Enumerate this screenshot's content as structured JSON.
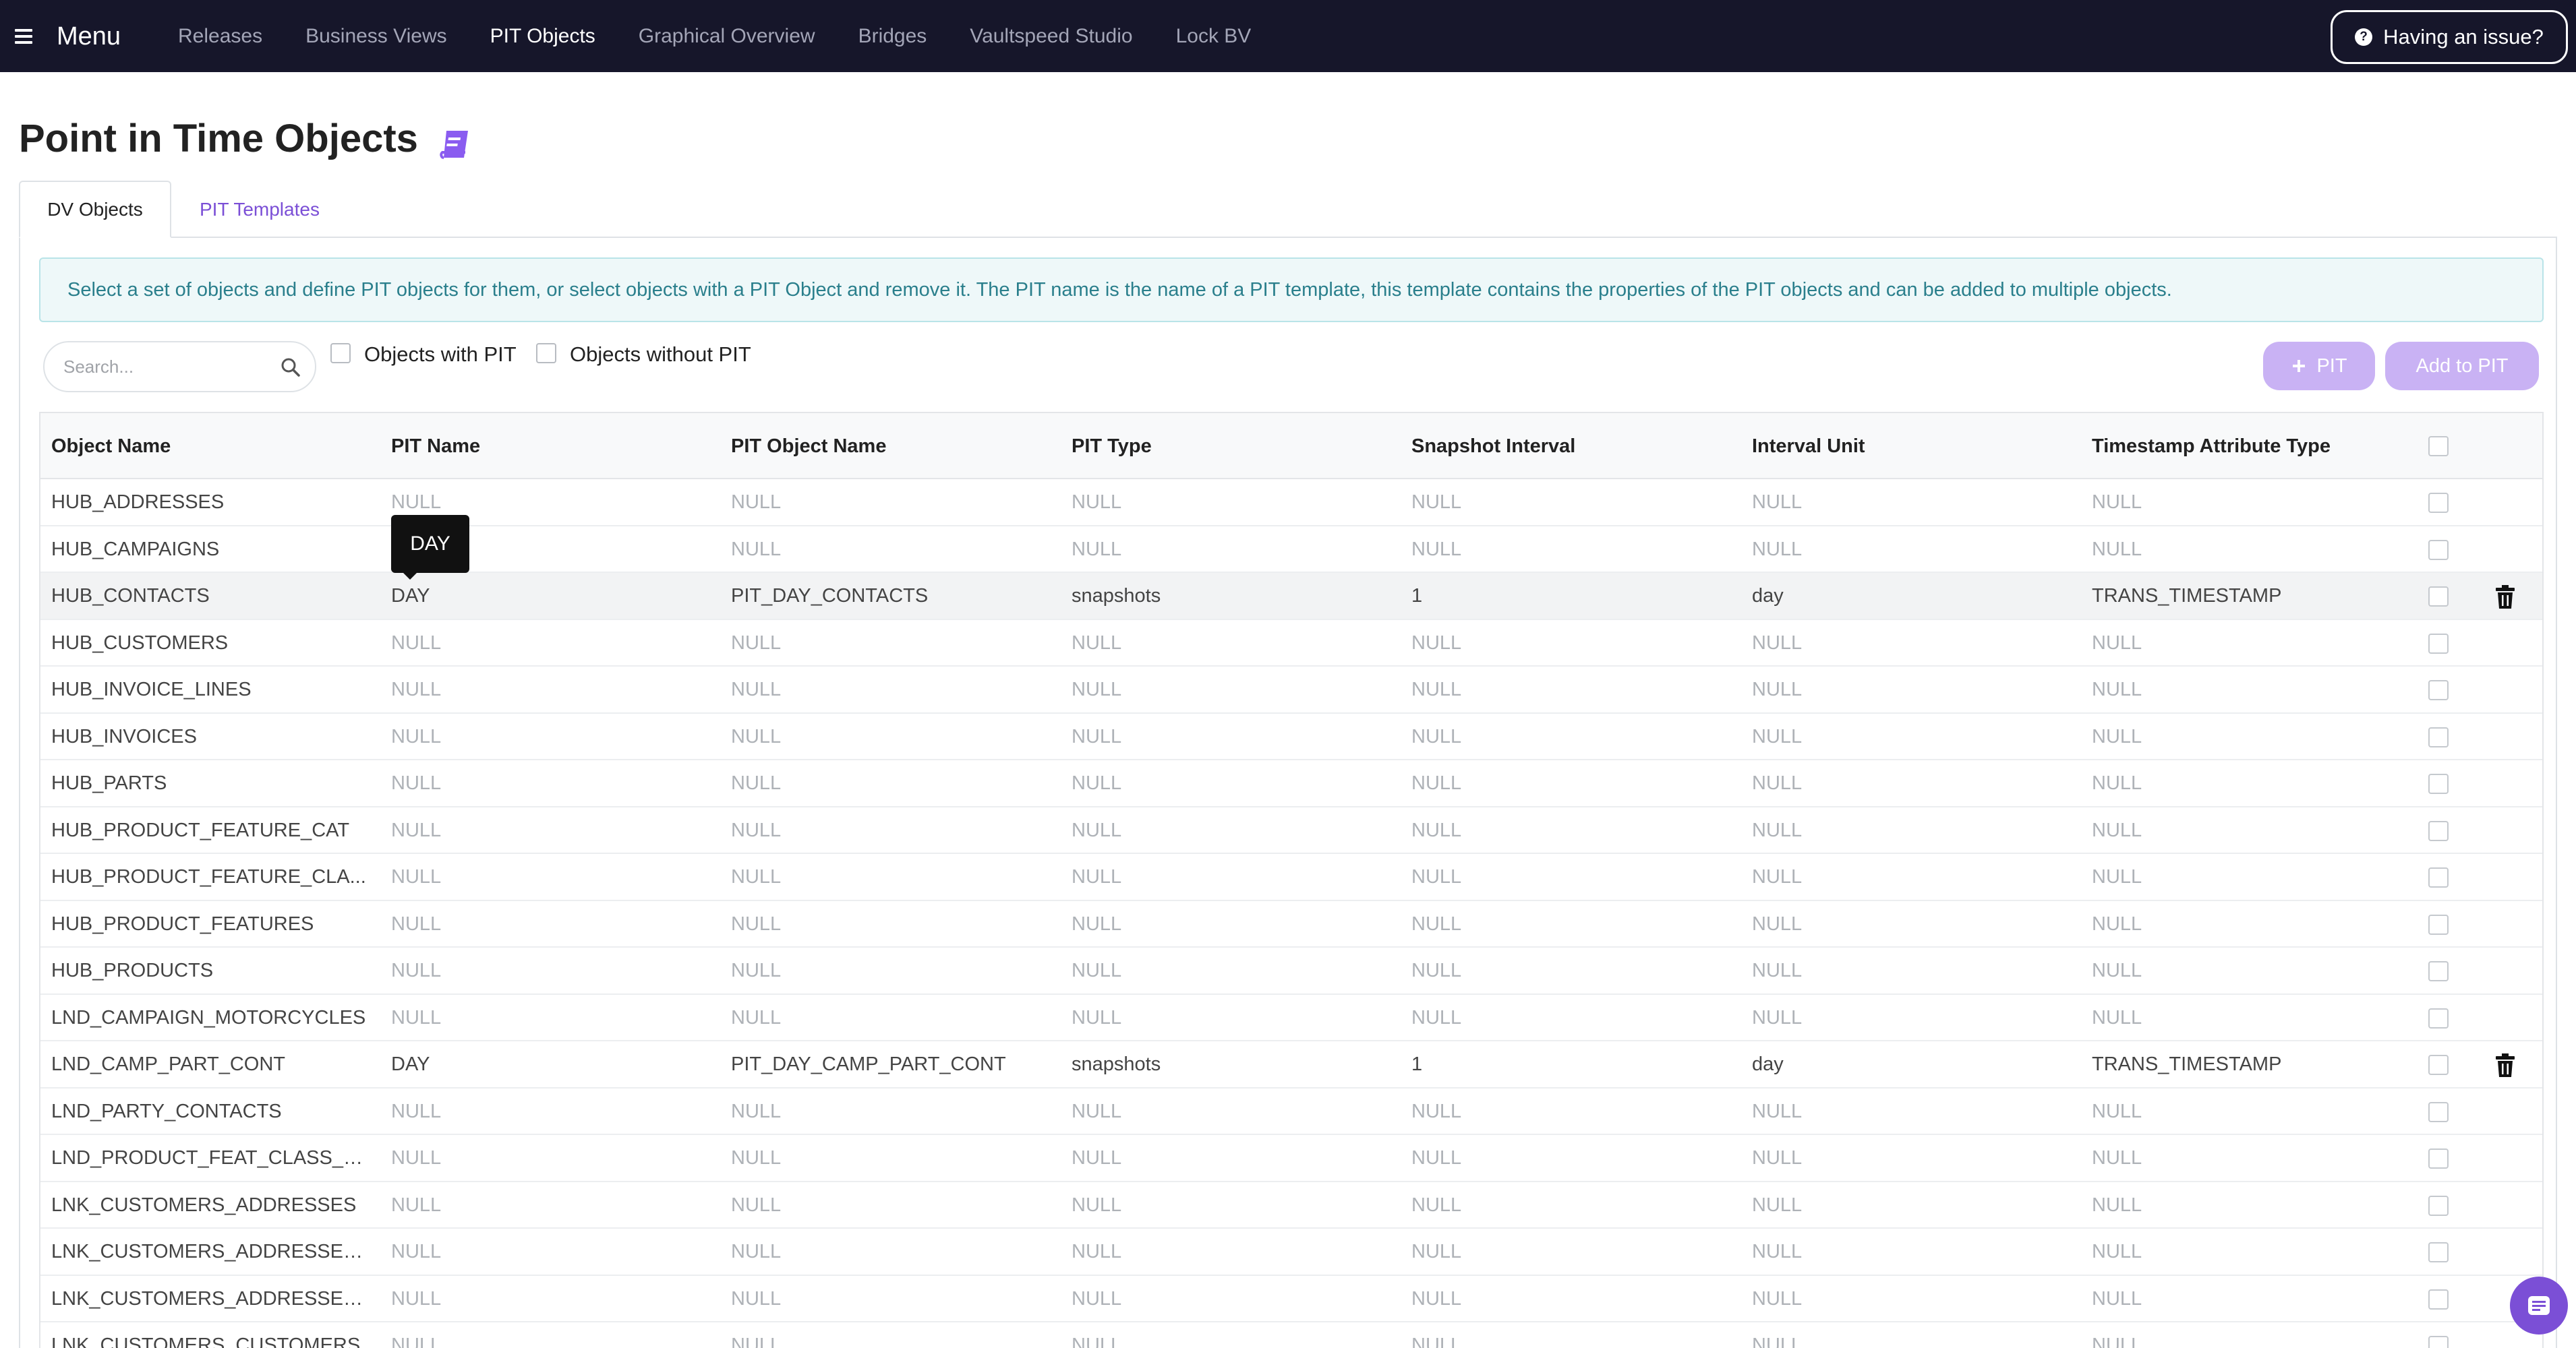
{
  "nav": {
    "menu_label": "Menu",
    "items": [
      {
        "label": "Releases",
        "active": false
      },
      {
        "label": "Business Views",
        "active": false
      },
      {
        "label": "PIT Objects",
        "active": true
      },
      {
        "label": "Graphical Overview",
        "active": false
      },
      {
        "label": "Bridges",
        "active": false
      },
      {
        "label": "Vaultspeed Studio",
        "active": false
      },
      {
        "label": "Lock BV",
        "active": false
      }
    ],
    "issue_button": "Having an issue?"
  },
  "page": {
    "title": "Point in Time Objects",
    "tabs": [
      {
        "label": "DV Objects",
        "active": true
      },
      {
        "label": "PIT Templates",
        "active": false
      }
    ],
    "info": "Select a set of objects and define PIT objects for them, or select objects with a PIT Object and remove it. The PIT name is the name of a PIT template, this template contains the properties of the PIT objects and can be added to multiple objects."
  },
  "filters": {
    "search_placeholder": "Search...",
    "with_pit_label": "Objects with PIT",
    "without_pit_label": "Objects without PIT"
  },
  "actions": {
    "pit_button": "PIT",
    "add_to_pit_button": "Add to PIT"
  },
  "table": {
    "columns": [
      "Object Name",
      "PIT Name",
      "PIT Object Name",
      "PIT Type",
      "Snapshot Interval",
      "Interval Unit",
      "Timestamp Attribute Type"
    ],
    "rows": [
      {
        "object": "HUB_ADDRESSES",
        "pit_name": "NULL",
        "pit_object": "NULL",
        "pit_type": "NULL",
        "interval": "NULL",
        "unit": "NULL",
        "ts_type": "NULL",
        "has_pit": false
      },
      {
        "object": "HUB_CAMPAIGNS",
        "pit_name": "NULL",
        "pit_object": "NULL",
        "pit_type": "NULL",
        "interval": "NULL",
        "unit": "NULL",
        "ts_type": "NULL",
        "has_pit": false
      },
      {
        "object": "HUB_CONTACTS",
        "pit_name": "DAY",
        "pit_object": "PIT_DAY_CONTACTS",
        "pit_type": "snapshots",
        "interval": "1",
        "unit": "day",
        "ts_type": "TRANS_TIMESTAMP",
        "has_pit": true,
        "highlight": true
      },
      {
        "object": "HUB_CUSTOMERS",
        "pit_name": "NULL",
        "pit_object": "NULL",
        "pit_type": "NULL",
        "interval": "NULL",
        "unit": "NULL",
        "ts_type": "NULL",
        "has_pit": false
      },
      {
        "object": "HUB_INVOICE_LINES",
        "pit_name": "NULL",
        "pit_object": "NULL",
        "pit_type": "NULL",
        "interval": "NULL",
        "unit": "NULL",
        "ts_type": "NULL",
        "has_pit": false
      },
      {
        "object": "HUB_INVOICES",
        "pit_name": "NULL",
        "pit_object": "NULL",
        "pit_type": "NULL",
        "interval": "NULL",
        "unit": "NULL",
        "ts_type": "NULL",
        "has_pit": false
      },
      {
        "object": "HUB_PARTS",
        "pit_name": "NULL",
        "pit_object": "NULL",
        "pit_type": "NULL",
        "interval": "NULL",
        "unit": "NULL",
        "ts_type": "NULL",
        "has_pit": false
      },
      {
        "object": "HUB_PRODUCT_FEATURE_CAT",
        "pit_name": "NULL",
        "pit_object": "NULL",
        "pit_type": "NULL",
        "interval": "NULL",
        "unit": "NULL",
        "ts_type": "NULL",
        "has_pit": false
      },
      {
        "object": "HUB_PRODUCT_FEATURE_CLA...",
        "pit_name": "NULL",
        "pit_object": "NULL",
        "pit_type": "NULL",
        "interval": "NULL",
        "unit": "NULL",
        "ts_type": "NULL",
        "has_pit": false
      },
      {
        "object": "HUB_PRODUCT_FEATURES",
        "pit_name": "NULL",
        "pit_object": "NULL",
        "pit_type": "NULL",
        "interval": "NULL",
        "unit": "NULL",
        "ts_type": "NULL",
        "has_pit": false
      },
      {
        "object": "HUB_PRODUCTS",
        "pit_name": "NULL",
        "pit_object": "NULL",
        "pit_type": "NULL",
        "interval": "NULL",
        "unit": "NULL",
        "ts_type": "NULL",
        "has_pit": false
      },
      {
        "object": "LND_CAMPAIGN_MOTORCYCLES",
        "pit_name": "NULL",
        "pit_object": "NULL",
        "pit_type": "NULL",
        "interval": "NULL",
        "unit": "NULL",
        "ts_type": "NULL",
        "has_pit": false
      },
      {
        "object": "LND_CAMP_PART_CONT",
        "pit_name": "DAY",
        "pit_object": "PIT_DAY_CAMP_PART_CONT",
        "pit_type": "snapshots",
        "interval": "1",
        "unit": "day",
        "ts_type": "TRANS_TIMESTAMP",
        "has_pit": true
      },
      {
        "object": "LND_PARTY_CONTACTS",
        "pit_name": "NULL",
        "pit_object": "NULL",
        "pit_type": "NULL",
        "interval": "NULL",
        "unit": "NULL",
        "ts_type": "NULL",
        "has_pit": false
      },
      {
        "object": "LND_PRODUCT_FEAT_CLASS_R...",
        "pit_name": "NULL",
        "pit_object": "NULL",
        "pit_type": "NULL",
        "interval": "NULL",
        "unit": "NULL",
        "ts_type": "NULL",
        "has_pit": false
      },
      {
        "object": "LNK_CUSTOMERS_ADDRESSES",
        "pit_name": "NULL",
        "pit_object": "NULL",
        "pit_type": "NULL",
        "interval": "NULL",
        "unit": "NULL",
        "ts_type": "NULL",
        "has_pit": false
      },
      {
        "object": "LNK_CUSTOMERS_ADDRESSES...",
        "pit_name": "NULL",
        "pit_object": "NULL",
        "pit_type": "NULL",
        "interval": "NULL",
        "unit": "NULL",
        "ts_type": "NULL",
        "has_pit": false
      },
      {
        "object": "LNK_CUSTOMERS_ADDRESSES...",
        "pit_name": "NULL",
        "pit_object": "NULL",
        "pit_type": "NULL",
        "interval": "NULL",
        "unit": "NULL",
        "ts_type": "NULL",
        "has_pit": false
      },
      {
        "object": "LNK_CUSTOMERS_CUSTOMERS",
        "pit_name": "NULL",
        "pit_object": "NULL",
        "pit_type": "NULL",
        "interval": "NULL",
        "unit": "NULL",
        "ts_type": "NULL",
        "has_pit": false
      }
    ]
  },
  "tooltip": {
    "text": "DAY"
  },
  "colors": {
    "nav_bg": "#16162a",
    "accent": "#7b4fd6",
    "button_disabled": "#c9b2f4",
    "info_text": "#2a7f8c",
    "null_text": "#aeb2b7"
  },
  "icons": {
    "menu": "hamburger-icon",
    "issue": "question-circle-icon",
    "title": "book-icon",
    "search": "search-icon",
    "plus": "plus-icon",
    "delete": "trash-icon",
    "chat": "chat-icon"
  }
}
